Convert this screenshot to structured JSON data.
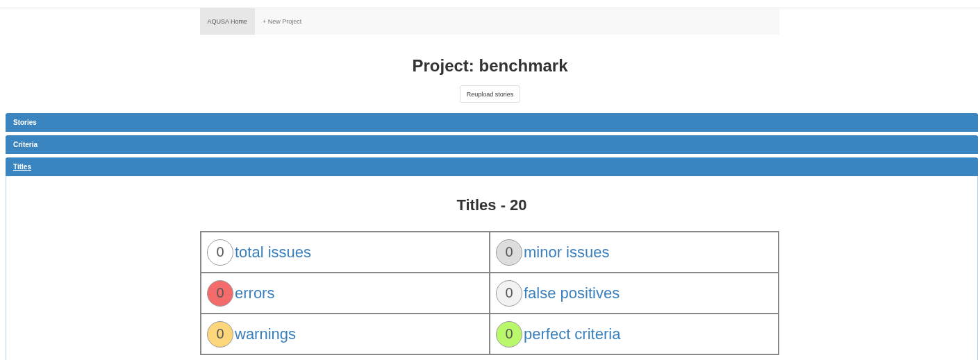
{
  "nav": {
    "items": [
      {
        "label": "AQUSA Home",
        "selected": true
      },
      {
        "label": "+ New Project",
        "selected": false
      }
    ]
  },
  "title": "Project: benchmark",
  "reupload_button": "Reupload stories",
  "sections": [
    {
      "label": "Stories",
      "expanded": false
    },
    {
      "label": "Criteria",
      "expanded": false
    },
    {
      "label": "Titles",
      "expanded": true,
      "heading": "Titles - 20",
      "stats": [
        {
          "count": "0",
          "label": "total issues",
          "color": "#ffffff"
        },
        {
          "count": "0",
          "label": "minor issues",
          "color": "#dddddd"
        },
        {
          "count": "0",
          "label": "errors",
          "color": "#f46b6b"
        },
        {
          "count": "0",
          "label": "false positives",
          "color": "#f2f2f2"
        },
        {
          "count": "0",
          "label": "warnings",
          "color": "#fdd57a"
        },
        {
          "count": "0",
          "label": "perfect criteria",
          "color": "#b9f86b"
        }
      ]
    }
  ]
}
